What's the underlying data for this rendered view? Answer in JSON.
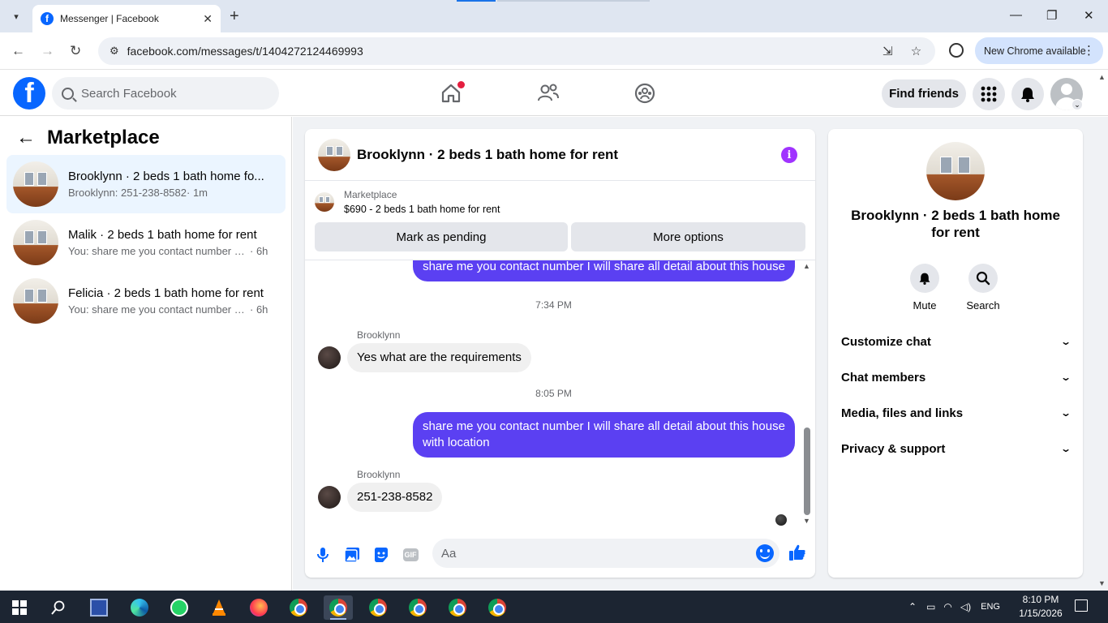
{
  "browser": {
    "tab_title": "Messenger | Facebook",
    "tab_close": "✕",
    "new_tab": "+",
    "url": "facebook.com/messages/t/1404272124469993",
    "update_label": "New Chrome available"
  },
  "fb_header": {
    "logo": "f",
    "search_placeholder": "Search Facebook",
    "find_friends": "Find friends"
  },
  "sidebar": {
    "title": "Marketplace",
    "conversations": [
      {
        "name": "Brooklynn · 2 beds 1 bath home fo...",
        "preview": "Brooklynn: 251-238-8582",
        "time": "· 1m"
      },
      {
        "name": "Malik · 2 beds 1 bath home for rent",
        "preview": "You: share me you contact number I ...",
        "time": "· 6h"
      },
      {
        "name": "Felicia · 2 beds 1 bath home for rent",
        "preview": "You: share me you contact number I ...",
        "time": "· 6h"
      }
    ]
  },
  "chat": {
    "title": "Brooklynn · 2 beds 1 bath home for rent",
    "listing_label": "Marketplace",
    "listing_detail": "$690 - 2 beds 1 bath home for rent",
    "mark_pending": "Mark as pending",
    "more_options": "More options",
    "messages": {
      "out1": "share me you contact number I will share all detail about this house",
      "time1": "7:34 PM",
      "sender1": "Brooklynn",
      "in1": "Yes what are the requirements",
      "time2": "8:05 PM",
      "out2": "share me you contact number I will share all detail about this house with location",
      "sender2": "Brooklynn",
      "in2": "251-238-8582"
    },
    "input_placeholder": "Aa",
    "gif_label": "GIF"
  },
  "details": {
    "title": "Brooklynn · 2 beds 1 bath home for rent",
    "mute": "Mute",
    "search": "Search",
    "sections": [
      "Customize chat",
      "Chat members",
      "Media, files and links",
      "Privacy & support"
    ]
  },
  "taskbar": {
    "lang": "ENG",
    "time": "8:10 PM",
    "date": "1/15/2026"
  },
  "colors": {
    "fb_blue": "#0866ff",
    "outgoing_bubble": "#5b40f2",
    "selected_conversation": "#ebf5ff",
    "info_purple": "#a033ff"
  }
}
